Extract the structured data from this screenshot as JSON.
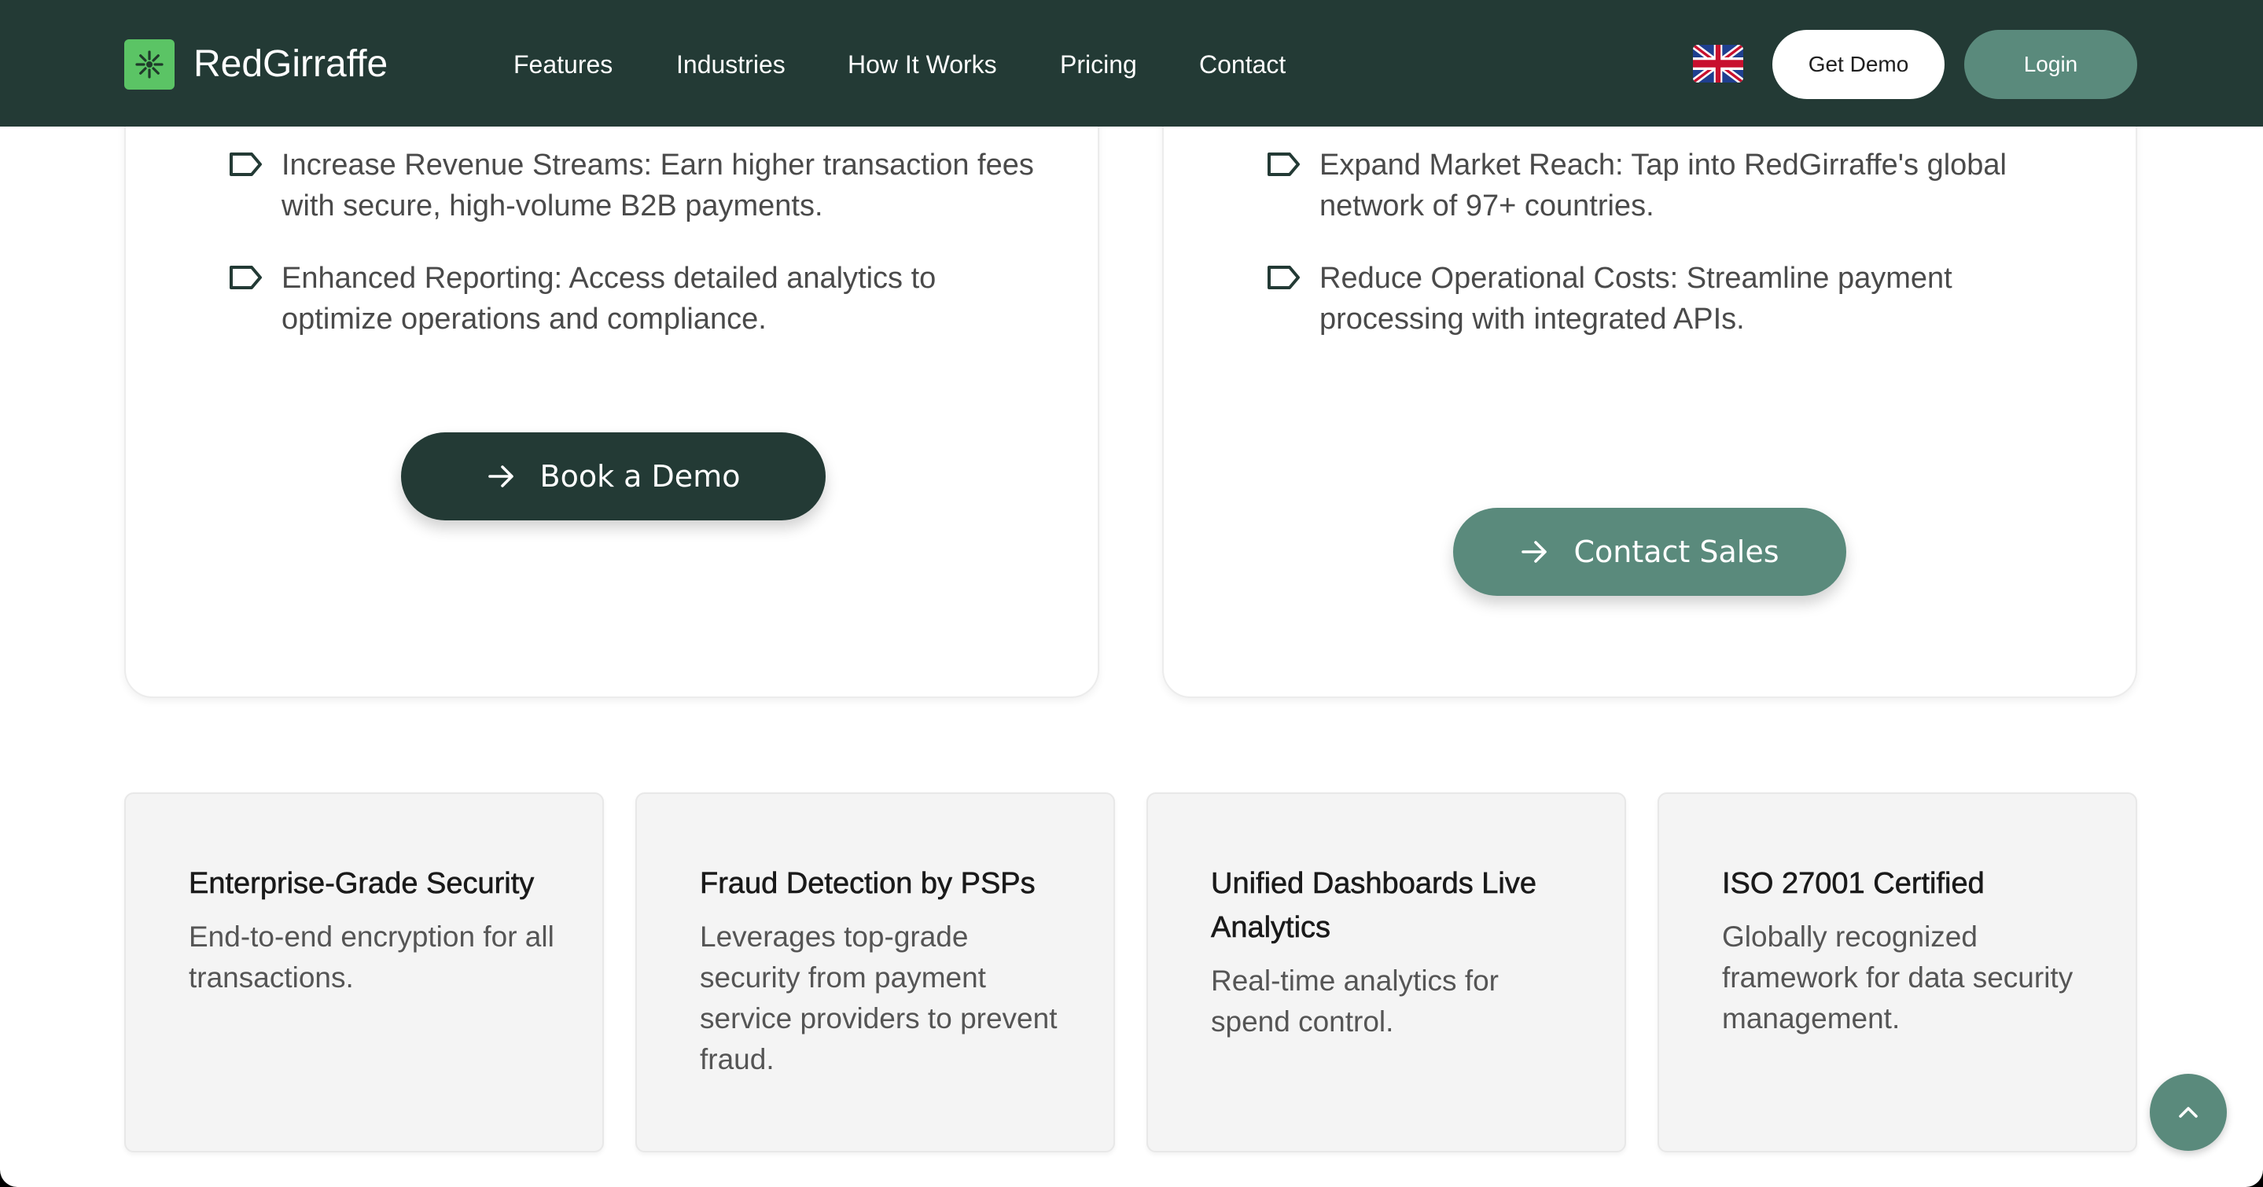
{
  "nav": {
    "brand": "RedGirraffe",
    "links": [
      "Features",
      "Industries",
      "How It Works",
      "Pricing",
      "Contact"
    ],
    "language_icon": "uk-flag-icon",
    "get_demo": "Get Demo",
    "login": "Login"
  },
  "left_card": {
    "bullets": [
      "Increase Revenue Streams: Earn higher transaction fees with secure, high-volume B2B payments.",
      "Enhanced Reporting: Access detailed analytics to optimize operations and compliance."
    ],
    "cta": "Book a Demo"
  },
  "right_card": {
    "bullets": [
      "Expand Market Reach: Tap into RedGirraffe's global network of 97+ countries.",
      "Reduce Operational Costs: Streamline payment processing with integrated APIs."
    ],
    "cta": "Contact Sales"
  },
  "features": [
    {
      "title": "Enterprise-Grade Security",
      "desc": "End-to-end encryption for all transactions."
    },
    {
      "title": "Fraud Detection by PSPs",
      "desc": "Leverages top-grade security from payment service providers to prevent fraud."
    },
    {
      "title": "Unified Dashboards Live Analytics",
      "desc": "Real-time analytics for spend control."
    },
    {
      "title": "ISO 27001 Certified",
      "desc": "Globally recognized framework for data security management."
    }
  ],
  "colors": {
    "nav_bg": "#233a35",
    "primary_dark": "#233a35",
    "accent_green": "#5a8a7c",
    "logo_green": "#5bc465"
  }
}
